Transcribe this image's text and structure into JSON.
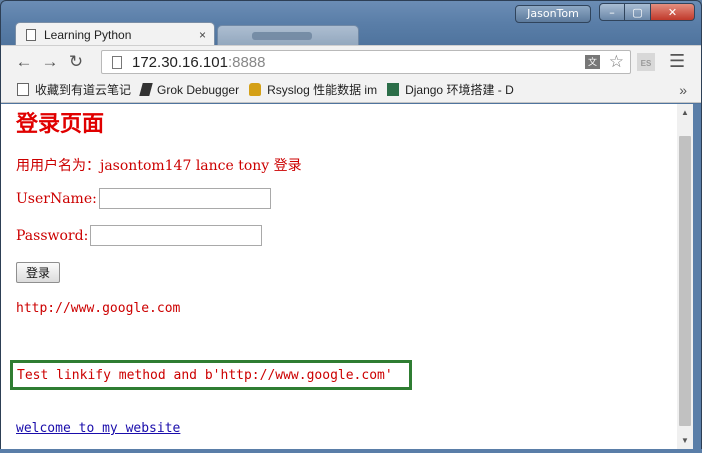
{
  "window": {
    "user_name": "JasonTom",
    "controls": {
      "minimize": "–",
      "maximize": "▢",
      "close": "✕"
    }
  },
  "tabs": [
    {
      "title": "Learning Python",
      "close": "×",
      "active": true
    },
    {
      "title": "",
      "active": false
    }
  ],
  "toolbar": {
    "back_icon": "arrow-left",
    "forward_icon": "arrow-right",
    "reload_icon": "reload",
    "url_host": "172.30.16.101",
    "url_port": ":8888",
    "translate_icon": "translate",
    "star_icon": "star",
    "extension_label": "ES",
    "menu_icon": "hamburger-menu"
  },
  "bookmarks": [
    {
      "label": "收藏到有道云笔记"
    },
    {
      "label": "Grok Debugger"
    },
    {
      "label": "Rsyslog 性能数据 im"
    },
    {
      "label": "Django 环境搭建 - D"
    }
  ],
  "bookmarks_more": "»",
  "page": {
    "title": "登录页面",
    "user_hint": "用用户名为：jasontom147 lance tony 登录",
    "username_label": "UserName:",
    "username_value": "",
    "password_label": "Password:",
    "password_value": "",
    "login_button": "登录",
    "google_text": "http://www.google.com",
    "linkify_text": "Test linkify method and b'http://www.google.com'",
    "welcome_link": "welcome to my website"
  },
  "colors": {
    "title_red": "#e00000",
    "text_red": "#cc0000",
    "highlight_green": "#2f7d32",
    "link_blue": "#1a0dab"
  }
}
